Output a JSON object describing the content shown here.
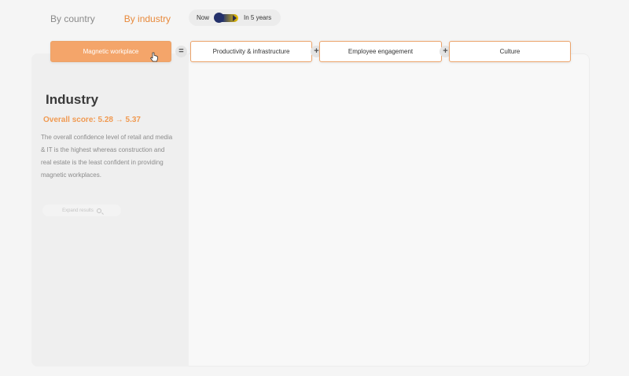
{
  "view_tabs": [
    {
      "label": "By country",
      "active": false
    },
    {
      "label": "By industry",
      "active": true
    }
  ],
  "time_toggle": {
    "left_label": "Now",
    "right_label": "In 5 years"
  },
  "formula": {
    "result": "Magnetic workplace",
    "equals_sign": "=",
    "plus_sign": "+",
    "components": [
      "Productivity & infrastructure",
      "Employee engagement",
      "Culture"
    ]
  },
  "panel": {
    "title": "Industry",
    "overall_score": "Overall score: 5.28 → 5.37",
    "description": "The overall confidence level of retail and media & IT is the highest whereas construction and real estate is the least confident in providing magnetic workplaces.",
    "expand_label": "Expand results"
  },
  "colors": {
    "accent": "#f4a56a",
    "accent_text": "#f09a52",
    "toggle_dark": "#23306a",
    "toggle_yellow": "#f0c400"
  }
}
